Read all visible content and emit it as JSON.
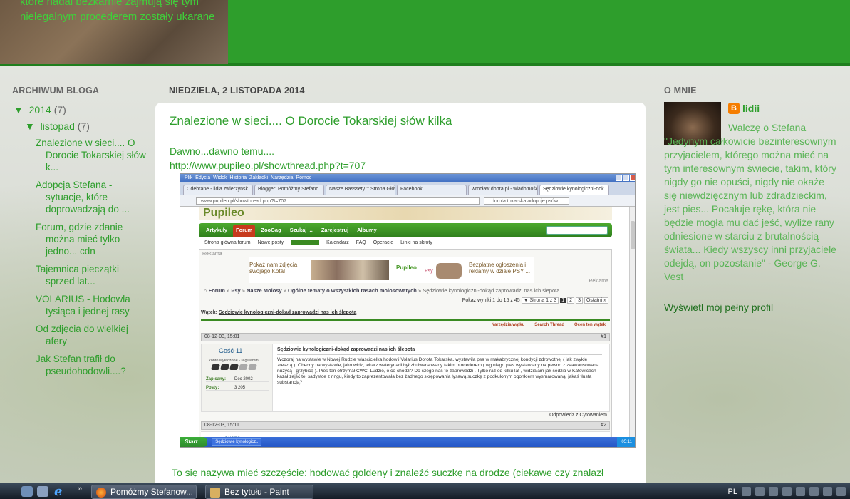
{
  "header": {
    "text": "które nadal bezkarnie zajmują się tym nielegalnym procederem zostały ukarane"
  },
  "archive": {
    "heading": "ARCHIWUM BLOGA",
    "year": {
      "toggle": "▼",
      "label": "2014",
      "count": "(7)"
    },
    "month": {
      "toggle": "▼",
      "label": "listopad",
      "count": "(7)"
    },
    "posts": [
      "Znalezione w sieci.... O Dorocie Tokarskiej słów k...",
      "Adopcja Stefana - sytuacje, które doprowadzają do ...",
      "Forum, gdzie zdanie można mieć tylko jedno... cdn",
      "Tajemnica pieczątki sprzed lat...",
      "VOLARIUS - Hodowla tysiąca i jednej rasy",
      "Od zdjęcia do wielkiej afery",
      "Jak Stefan trafił do pseudohodowli....?"
    ]
  },
  "post": {
    "date": "NIEDZIELA, 2 LISTOPADA 2014",
    "title": "Znalezione w sieci.... O Dorocie Tokarskiej słów kilka",
    "intro": "Dawno...dawno temu....",
    "url": "http://www.pupileo.pl/showthread.php?t=707",
    "bottom": "To się nazywa mieć szczęście: hodować goldeny i znaleźć suczkę na drodze (ciekawe czy znalazł"
  },
  "screenshot": {
    "menu": [
      "Plik",
      "Edycja",
      "Widok",
      "Historia",
      "Zakładki",
      "Narzędzia",
      "Pomoc"
    ],
    "tabs": [
      "Odebrane - lidia.zwierzynsk...",
      "Blogger: Pomóżmy Stefano...",
      "Nasze Basssety :: Strona Główna",
      "Facebook",
      "wrocław.dobra.pl - wiadomości z...",
      "Sędziowie kynologiczni-dok..."
    ],
    "address": "www.pupileo.pl/showthread.php?t=707",
    "search": "dorota tokarska adopcje psów",
    "banner": "Pupileo",
    "nav": [
      "Artykuły",
      "Forum",
      "ZooGag",
      "Szukaj ...",
      "Zarejestruj",
      "Albumy"
    ],
    "subnav": [
      "Strona główna forum",
      "Nowe posty",
      "Kalendarz",
      "FAQ",
      "Operacje",
      "Linki na skróty"
    ],
    "reklama": "Reklama",
    "ad_left": "Pokaż nam zdjęcia swojego Kota!",
    "ad_logo": "Pupileo",
    "ad_psy": "Psy",
    "ad_right": "Bezpłatne ogłoszenia i reklamy w dziale PSY ...",
    "breadcrumb": [
      "Forum",
      "Psy",
      "Nasze Molosy",
      "Ogólne tematy o wszystkich rasach molosowatych",
      "Sędziowie kynologiczni-dokąd zaprowadzi nas ich ślepota"
    ],
    "pager_info": "Pokaż wyniki 1 do 15 z 45",
    "pager_page": "▼ Strona 1 z 3",
    "pager_pages": [
      "1",
      "2",
      "3"
    ],
    "pager_next": "Ostatni »",
    "thread_label": "Wątek:",
    "thread_title": "Sędziowie kynologiczni-dokąd zaprowadzi nas ich ślepota",
    "tools": [
      "Narzędzia wątku",
      "Search Thread",
      "Oceń ten wątek"
    ],
    "post1_date": "08-12-03, 15:01",
    "post1_num": "#1",
    "author": "Gość-11",
    "author_role": "konto wyłączone - regulamin",
    "joined_label": "Zapisany:",
    "joined": "Dec 2002",
    "posts_label": "Posty:",
    "posts_count": "3 205",
    "post_title": "Sędziowie kynologiczni-dokąd zaprowadzi nas ich ślepota",
    "post_body": "Wczoraj na wystawie w Nowej Rudzie właścicielka hodowli Volarius Dorota Tokarska, wystawiła psa w makabrycznej kondycji zdrowotnej ( jak zwykle zresztą ). Obecny na wystawie, jako widz, lekarz weterynarii był zbulwersowany takim procederem ( wg niego pies wystawiany na pewno z zaawansowana nużycą , grzybicą ). Pies ten otrzymał CWC. Ludzie, o co chodzi? Do czego nas to zaprowadzi . Tylko raz od kilku lat , widziałam jak sędzia w Katowicach kazał zejść tej sadystce z ringu, kiedy to zaprezentowała bez żadnego skrępowania łysawą suczkę z podkulonym ogonkiem wysmarowaną, jakąś tłustą substancją?",
    "reply": "Odpowiedz z Cytowaniem",
    "post2_date": "08-12-03, 15:11",
    "post2_num": "#2",
    "post2_author": "Iwona",
    "start": "Start",
    "task": "Sędziowie kynologicz...",
    "time": "05:11"
  },
  "about": {
    "heading": "O MNIE",
    "name": "lidii",
    "bio": "Walczę o Stefana \"Jedynym całkowicie bezinteresownym przyjacielem, którego można mieć na tym interesownym świecie, takim, który nigdy go nie opuści, nigdy nie okaże się niewdzięcznym lub zdradzieckim, jest pies... Pocałuje rękę, która nie będzie mogła mu dać jeść, wyliże rany odniesione w starciu z brutalnością świata... Kiedy wszyscy inni przyjaciele odejdą, on pozostanie\" - George G. Vest",
    "full_profile": "Wyświetl mój pełny profil"
  },
  "taskbar": {
    "more": "»",
    "items": [
      "Pomóżmy Stefanow...",
      "Bez tytułu - Paint"
    ],
    "lang": "PL"
  },
  "colors": {
    "accent_green": "#2e9e2c",
    "header_green": "#2e9e2c"
  }
}
